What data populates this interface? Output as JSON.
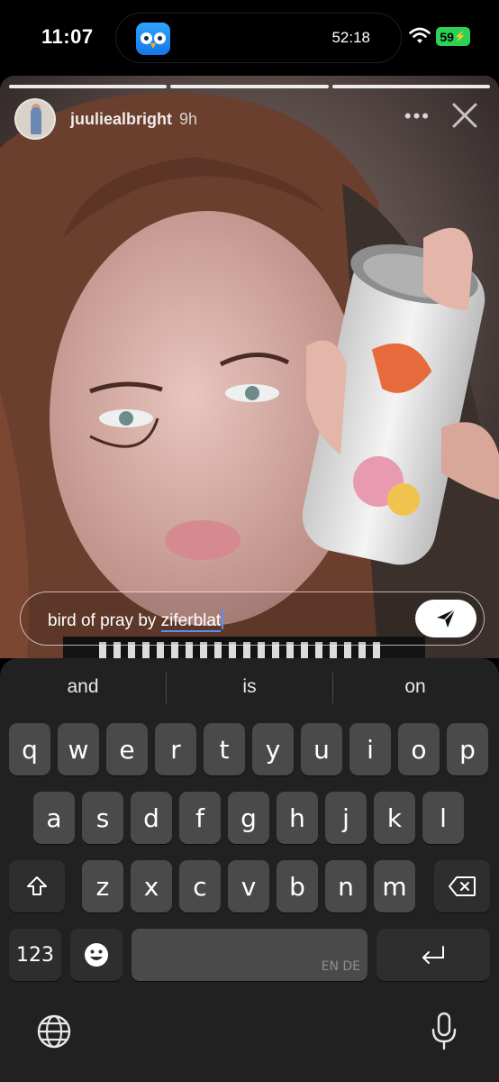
{
  "status_bar": {
    "time": "11:07",
    "island_timer": "52:18",
    "battery_level": "59",
    "island_app_icon": "owl-app-icon",
    "battery_color": "#2ed158"
  },
  "story": {
    "username": "juuliealbright",
    "age": "9h",
    "progress_segments": 3,
    "progress_current": 3,
    "more_label": "•••",
    "reply": {
      "text_before": "bird of pray by ",
      "text_underlined": "ziferblat"
    }
  },
  "keyboard": {
    "suggestions": [
      "and",
      "is",
      "on"
    ],
    "row1": [
      "q",
      "w",
      "e",
      "r",
      "t",
      "y",
      "u",
      "i",
      "o",
      "p"
    ],
    "row2": [
      "a",
      "s",
      "d",
      "f",
      "g",
      "h",
      "j",
      "k",
      "l"
    ],
    "row3": [
      "z",
      "x",
      "c",
      "v",
      "b",
      "n",
      "m"
    ],
    "numbers_label": "123",
    "space_language": "EN DE"
  }
}
